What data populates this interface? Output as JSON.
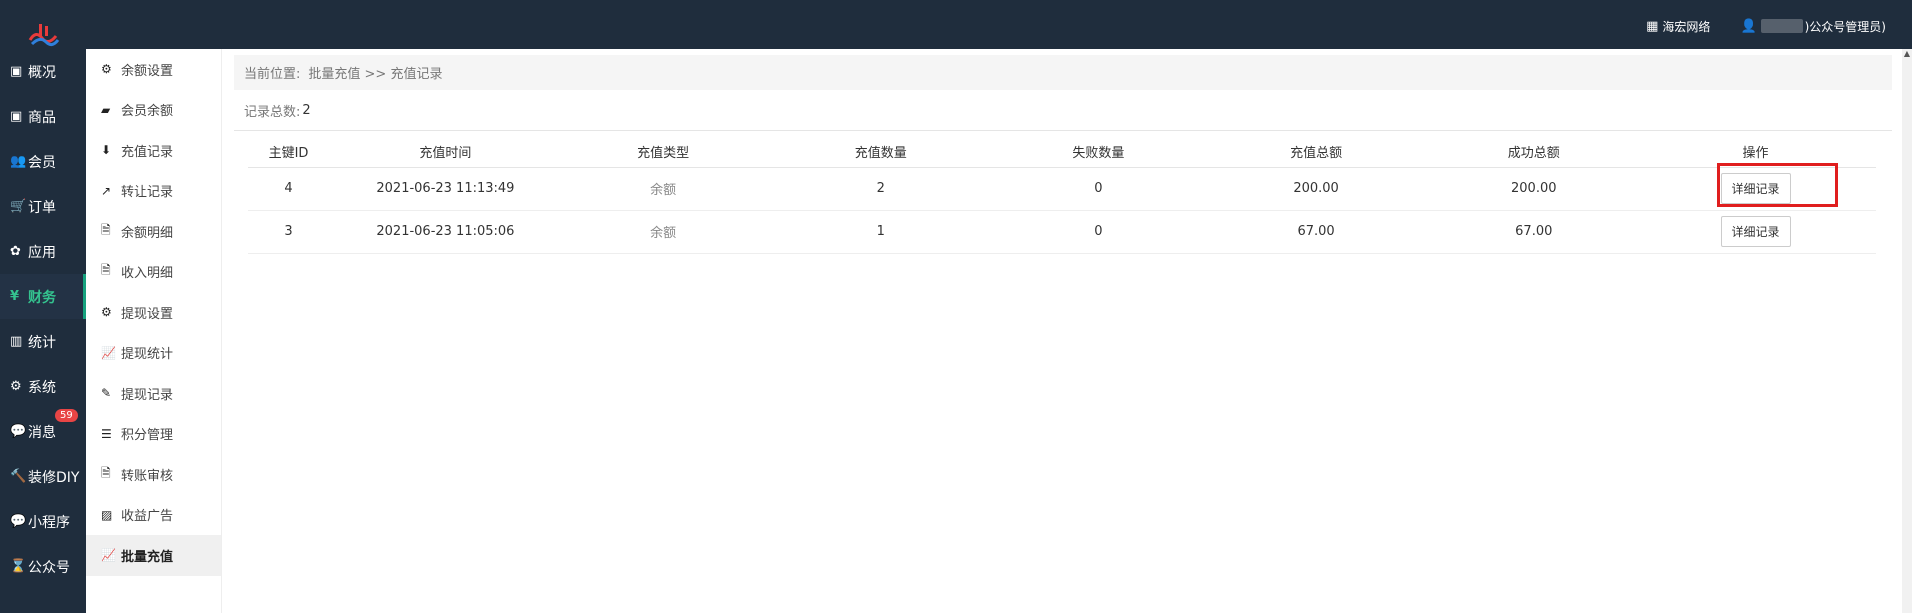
{
  "topbar": {
    "company_label": "海宏网络",
    "user_suffix": ")公众号管理员)"
  },
  "mainnav": {
    "items": [
      {
        "label": "概况",
        "icon": "dashboard-icon"
      },
      {
        "label": "商品",
        "icon": "product-icon"
      },
      {
        "label": "会员",
        "icon": "users-icon"
      },
      {
        "label": "订单",
        "icon": "cart-icon"
      },
      {
        "label": "应用",
        "icon": "apps-icon"
      },
      {
        "label": "财务",
        "icon": "yen-icon",
        "active": true
      },
      {
        "label": "统计",
        "icon": "bar-chart-icon"
      },
      {
        "label": "系统",
        "icon": "gear-icon"
      },
      {
        "label": "消息",
        "icon": "message-icon",
        "badge": "59"
      },
      {
        "label": "装修DIY",
        "icon": "hammer-icon"
      },
      {
        "label": "小程序",
        "icon": "wechat-icon"
      },
      {
        "label": "公众号",
        "icon": "hourglass-icon"
      }
    ]
  },
  "subnav": {
    "items": [
      {
        "label": "余额设置"
      },
      {
        "label": "会员余额"
      },
      {
        "label": "充值记录"
      },
      {
        "label": "转让记录"
      },
      {
        "label": "余额明细"
      },
      {
        "label": "收入明细"
      },
      {
        "label": "提现设置"
      },
      {
        "label": "提现统计"
      },
      {
        "label": "提现记录"
      },
      {
        "label": "积分管理"
      },
      {
        "label": "转账审核"
      },
      {
        "label": "收益广告"
      },
      {
        "label": "批量充值",
        "active": true
      }
    ]
  },
  "breadcrumb": {
    "prefix": "当前位置:",
    "path": "批量充值 >> 充值记录"
  },
  "summary": {
    "label": "记录总数:",
    "count": "2"
  },
  "table": {
    "headers": [
      "主键ID",
      "充值时间",
      "充值类型",
      "充值数量",
      "失败数量",
      "充值总额",
      "成功总额",
      "操作"
    ],
    "rows": [
      {
        "id": "4",
        "time": "2021-06-23 11:13:49",
        "type": "余额",
        "qty": "2",
        "failed": "0",
        "total": "200.00",
        "success_total": "200.00",
        "action": "详细记录"
      },
      {
        "id": "3",
        "time": "2021-06-23 11:05:06",
        "type": "余额",
        "qty": "1",
        "failed": "0",
        "total": "67.00",
        "success_total": "67.00",
        "action": "详细记录"
      }
    ]
  }
}
